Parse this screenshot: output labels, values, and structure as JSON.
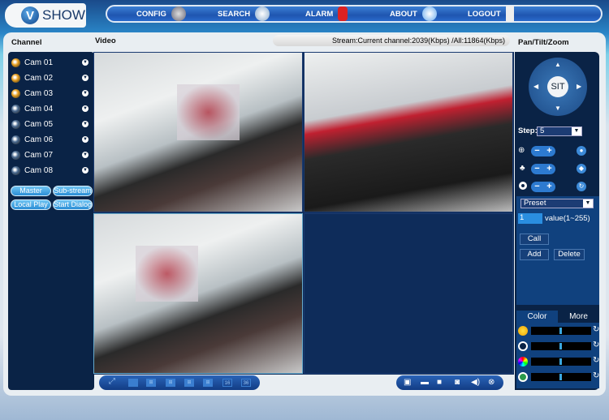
{
  "header": {
    "logo_letter": "V",
    "logo_text": "SHOW",
    "nav": [
      {
        "label": "CONFIG",
        "icon": "gear-icon"
      },
      {
        "label": "SEARCH",
        "icon": "magnifier-icon"
      },
      {
        "label": "ALARM",
        "icon": "alarm-siren-icon"
      },
      {
        "label": "ABOUT",
        "icon": "smiley-icon"
      },
      {
        "label": "LOGOUT",
        "icon": "door-icon"
      }
    ]
  },
  "sections": {
    "channel": "Channel",
    "video": "Video",
    "ptz": "Pan/Tilt/Zoom"
  },
  "stream": "Stream:Current channel:2039(Kbps) /All:11864(Kbps)",
  "channels": [
    {
      "label": "Cam 01",
      "active": true
    },
    {
      "label": "Cam 02",
      "active": true
    },
    {
      "label": "Cam 03",
      "active": true
    },
    {
      "label": "Cam 04",
      "active": false
    },
    {
      "label": "Cam 05",
      "active": false
    },
    {
      "label": "Cam 06",
      "active": false
    },
    {
      "label": "Cam 07",
      "active": false
    },
    {
      "label": "Cam 08",
      "active": false
    }
  ],
  "channel_buttons": {
    "master": "Master",
    "sub_stream": "Sub-stream",
    "local_play": "Local Play",
    "start_dialog": "Start Dialog"
  },
  "ptz": {
    "center": "SIT",
    "step_label": "Step:",
    "step_value": "5",
    "preset_select": "Preset",
    "preset_value": "1",
    "preset_range": "value(1~255)",
    "call": "Call",
    "add": "Add",
    "delete": "Delete"
  },
  "color_tabs": {
    "color": "Color",
    "more": "More"
  },
  "sliders": [
    {
      "name": "brightness",
      "value": 0.5
    },
    {
      "name": "contrast",
      "value": 0.5
    },
    {
      "name": "saturation",
      "value": 0.5
    },
    {
      "name": "hue",
      "value": 0.5
    }
  ],
  "colors": {
    "accent": "#2d7ad0",
    "panel": "#0a2346",
    "active_cam": "#e8a020",
    "inactive_cam": "#4a6a90"
  }
}
